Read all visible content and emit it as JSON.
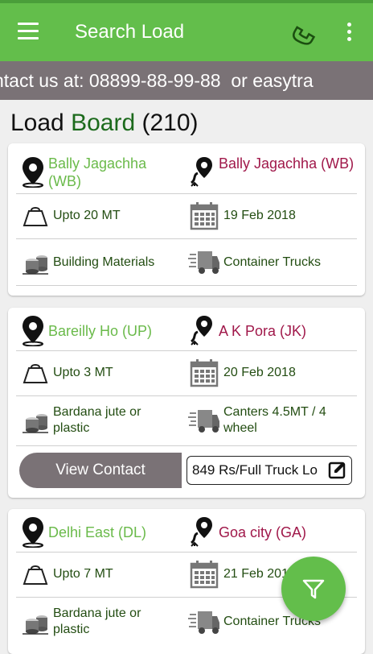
{
  "app": {
    "title": "Search Load",
    "menu_icon": "menu-icon",
    "phone_icon": "phone-icon",
    "more_icon": "more-vert-icon"
  },
  "marquee": {
    "text": "ntact us at: 08899-88-99-88  or easytra"
  },
  "board": {
    "title_part1": "Load ",
    "title_part2": "Board",
    "title_count": " (210)"
  },
  "colors": {
    "primary": "#63be4b",
    "from_text": "#6aba4a",
    "to_text": "#a0184a",
    "label_text": "#234d12",
    "grey": "#7a7276"
  },
  "loads": [
    {
      "from": "Bally Jagachha (WB)",
      "to": "Bally Jagachha (WB)",
      "weight": "Upto 20 MT",
      "date": "19 Feb 2018",
      "material": "Building Materials",
      "truck": "Container Trucks"
    },
    {
      "from": "Bareilly Ho (UP)",
      "to": "A K Pora (JK)",
      "weight": "Upto 3 MT",
      "date": "20 Feb 2018",
      "material": "Bardana jute or plastic",
      "truck": "Canters 4.5MT / 4 wheel",
      "view_contact": "View Contact",
      "price": "849 Rs/Full Truck Lo"
    },
    {
      "from": "Delhi East (DL)",
      "to": "Goa city (GA)",
      "weight": "Upto 7 MT",
      "date": "21 Feb 2018",
      "material": "Bardana jute or plastic",
      "truck": "Container Trucks"
    }
  ],
  "fab": {
    "icon": "filter-icon"
  }
}
